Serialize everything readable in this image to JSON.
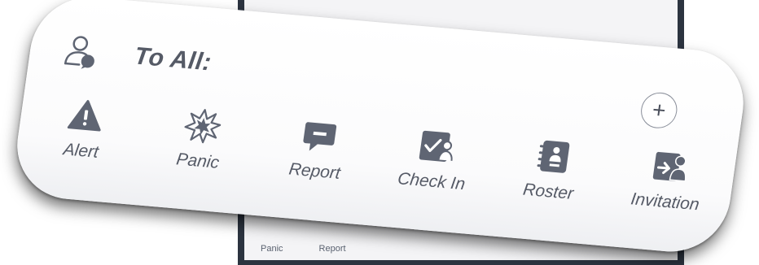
{
  "composer": {
    "to_label": "To All:",
    "add_symbol": "+",
    "recipient_icon": "person-chat-icon"
  },
  "actions": [
    {
      "label": "Alert",
      "icon": "warning-triangle-icon"
    },
    {
      "label": "Panic",
      "icon": "burst-icon"
    },
    {
      "label": "Report",
      "icon": "report-message-icon"
    },
    {
      "label": "Check In",
      "icon": "check-in-icon"
    },
    {
      "label": "Roster",
      "icon": "roster-notebook-icon"
    },
    {
      "label": "Invitation",
      "icon": "invitation-icon"
    }
  ],
  "background_tabs": [
    "Panic",
    "Report"
  ],
  "colors": {
    "icon": "#5f6573",
    "text": "#555a66",
    "phone_frame": "#2c3440"
  }
}
